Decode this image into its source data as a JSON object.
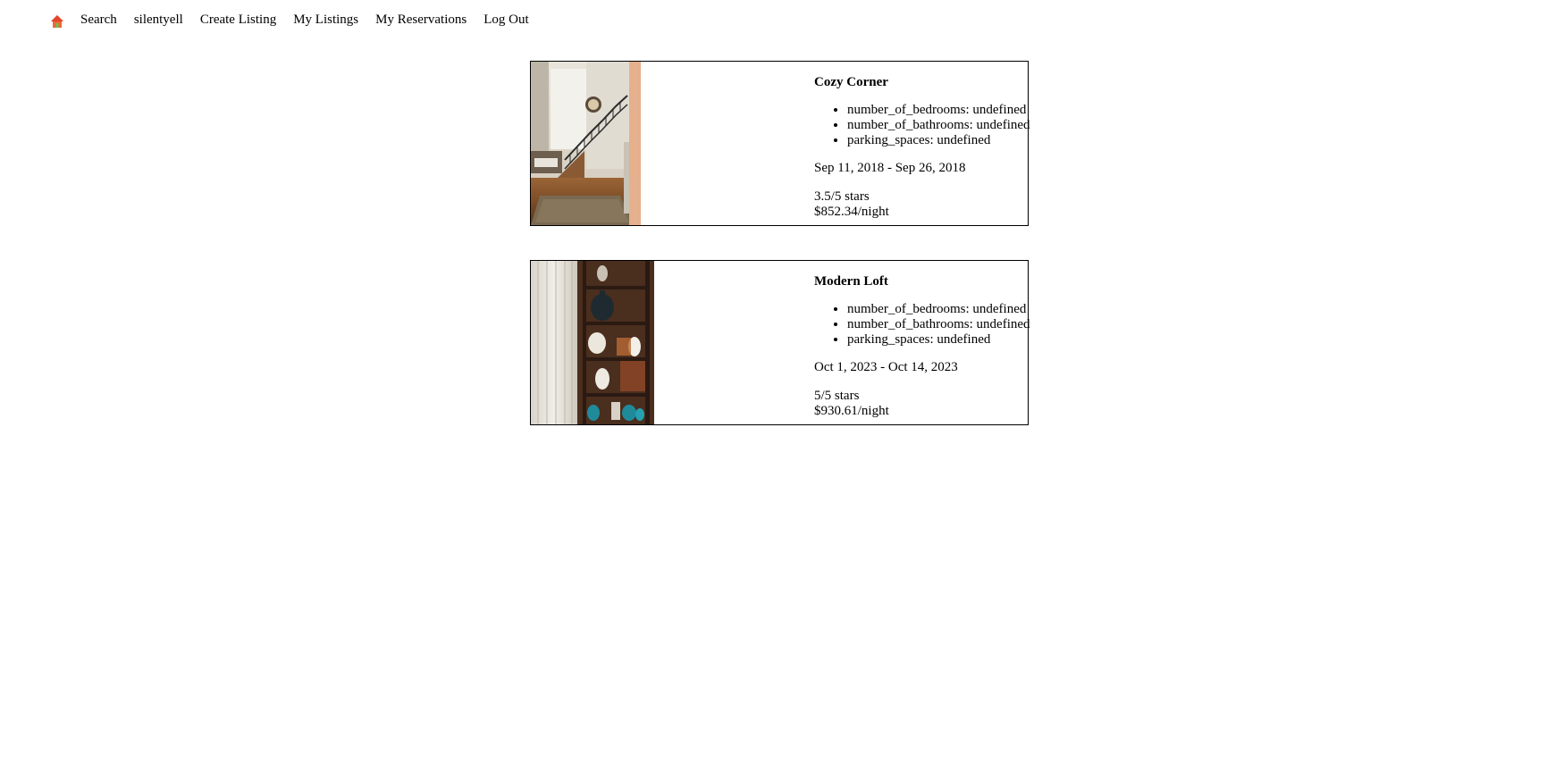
{
  "nav": {
    "home_icon": "home-icon",
    "links": [
      "Search",
      "silentyell",
      "Create Listing",
      "My Listings",
      "My Reservations",
      "Log Out"
    ]
  },
  "reservations": [
    {
      "title": "Cozy Corner",
      "details": [
        "number_of_bedrooms: undefined",
        "number_of_bathrooms: undefined",
        "parking_spaces: undefined"
      ],
      "dates": "Sep 11, 2018 - Sep 26, 2018",
      "rating": "3.5/5 stars",
      "price": "$852.34/night",
      "image": "staircase-interior-photo"
    },
    {
      "title": "Modern Loft",
      "details": [
        "number_of_bedrooms: undefined",
        "number_of_bathrooms: undefined",
        "parking_spaces: undefined"
      ],
      "dates": "Oct 1, 2023 - Oct 14, 2023",
      "rating": "5/5 stars",
      "price": "$930.61/night",
      "image": "shelf-vases-photo"
    }
  ]
}
